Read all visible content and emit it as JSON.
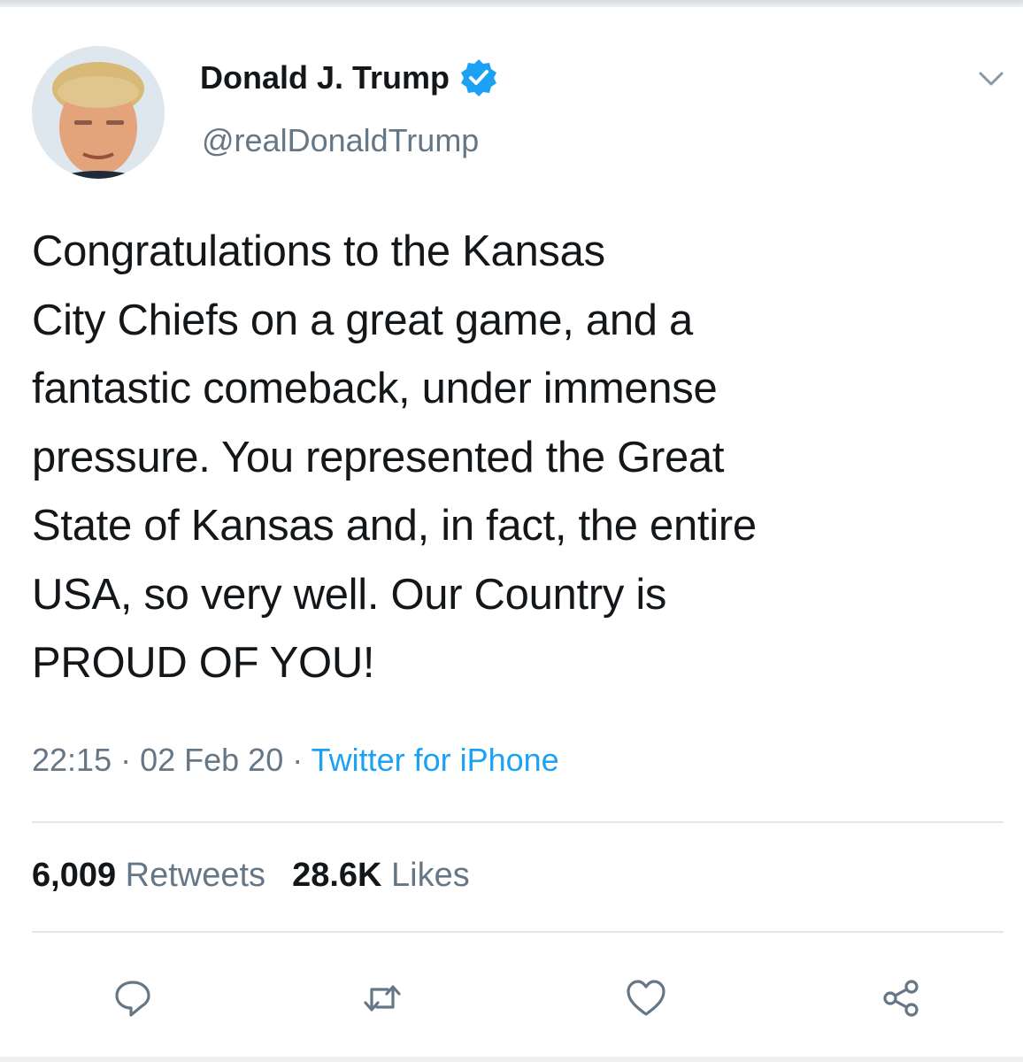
{
  "tweet": {
    "display_name": "Donald J. Trump",
    "handle": "@realDonaldTrump",
    "text": "Congratulations to the Kansas\nCity Chiefs on a great game, and a\nfantastic comeback, under immense\npressure. You represented the Great\nState of Kansas and, in fact, the entire\nUSA, so very well. Our Country is\nPROUD OF YOU!",
    "time": "22:15",
    "date": "02 Feb 20",
    "separator": " · ",
    "source": "Twitter for iPhone"
  },
  "stats": {
    "retweets_count": "6,009",
    "retweets_label": "Retweets",
    "likes_count": "28.6K",
    "likes_label": "Likes"
  },
  "icons": {
    "verified": "verified-badge-icon",
    "menu": "chevron-down-icon",
    "reply": "reply-icon",
    "retweet": "retweet-icon",
    "like": "heart-icon",
    "share": "share-icon"
  },
  "colors": {
    "accent": "#1da1f2",
    "muted": "#657786",
    "text": "#14171a",
    "divider": "#e1e8ed"
  }
}
